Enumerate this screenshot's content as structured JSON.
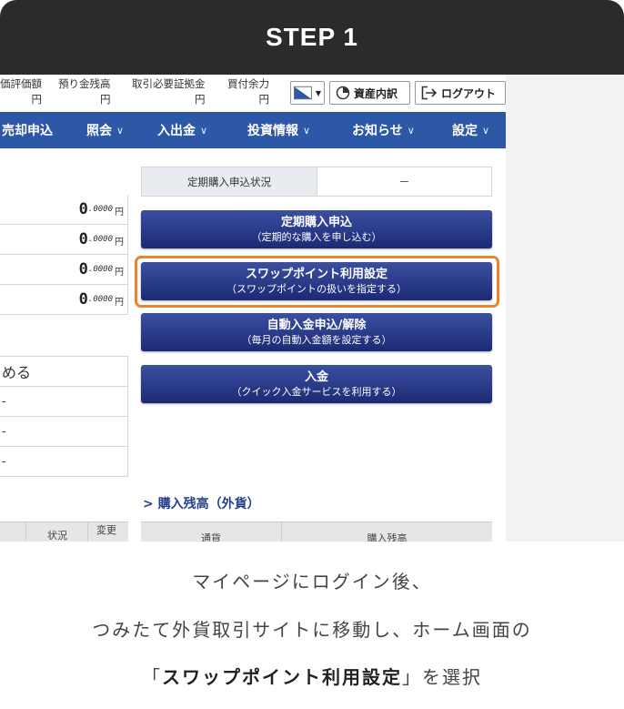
{
  "step": {
    "title": "STEP 1"
  },
  "screen": {
    "info": [
      {
        "label": "価評価額",
        "unit": "円"
      },
      {
        "label": "預り金残高",
        "unit": "円"
      },
      {
        "label": "取引必要証拠金",
        "unit": "円"
      },
      {
        "label": "買付余力",
        "unit": "円"
      }
    ],
    "toolbar": {
      "assets_label": "資産内訳",
      "logout_label": "ログアウト"
    },
    "nav": [
      {
        "label": "売却申込",
        "chevron": ""
      },
      {
        "label": "照会",
        "chevron": "∨"
      },
      {
        "label": "入出金",
        "chevron": "∨"
      },
      {
        "label": "投資情報",
        "chevron": "∨"
      },
      {
        "label": "お知らせ",
        "chevron": "∨"
      },
      {
        "label": "設定",
        "chevron": "∨"
      }
    ],
    "balances": [
      {
        "big": "0",
        "small": ".0000",
        "unit": "円"
      },
      {
        "big": "0",
        "small": ".0000",
        "unit": "円"
      },
      {
        "big": "0",
        "small": ".0000",
        "unit": "円"
      },
      {
        "big": "0",
        "small": ".0000",
        "unit": "円"
      }
    ],
    "left_box": [
      "める",
      "-",
      "-",
      "-"
    ],
    "left_table_headers": {
      "status": "状況",
      "change": "変更"
    },
    "status_row": {
      "key": "定期購入申込状況",
      "value": "－"
    },
    "actions": [
      {
        "title": "定期購入申込",
        "sub": "（定期的な購入を申し込む）"
      },
      {
        "title": "スワップポイント利用設定",
        "sub": "（スワップポイントの扱いを指定する）"
      },
      {
        "title": "自動入金申込/解除",
        "sub": "（毎月の自動入金額を設定する）"
      },
      {
        "title": "入金",
        "sub": "（クイック入金サービスを利用する）"
      }
    ],
    "purchase_section": {
      "title": "> 購入残高（外貨）",
      "col_currency": "通貨",
      "col_balance": "購入残高"
    },
    "colors": {
      "nav": "#2d58a8",
      "button": "#1b2a74",
      "highlight": "#e8852c",
      "step_bar": "#2b2b2b"
    }
  },
  "caption": {
    "line1": "マイページにログイン後、",
    "line2": "つみたて外貨取引サイトに移動し、ホーム画面の",
    "line3_open": "「",
    "line3_bold": "スワップポイント利用設定",
    "line3_close": "」を選択"
  }
}
